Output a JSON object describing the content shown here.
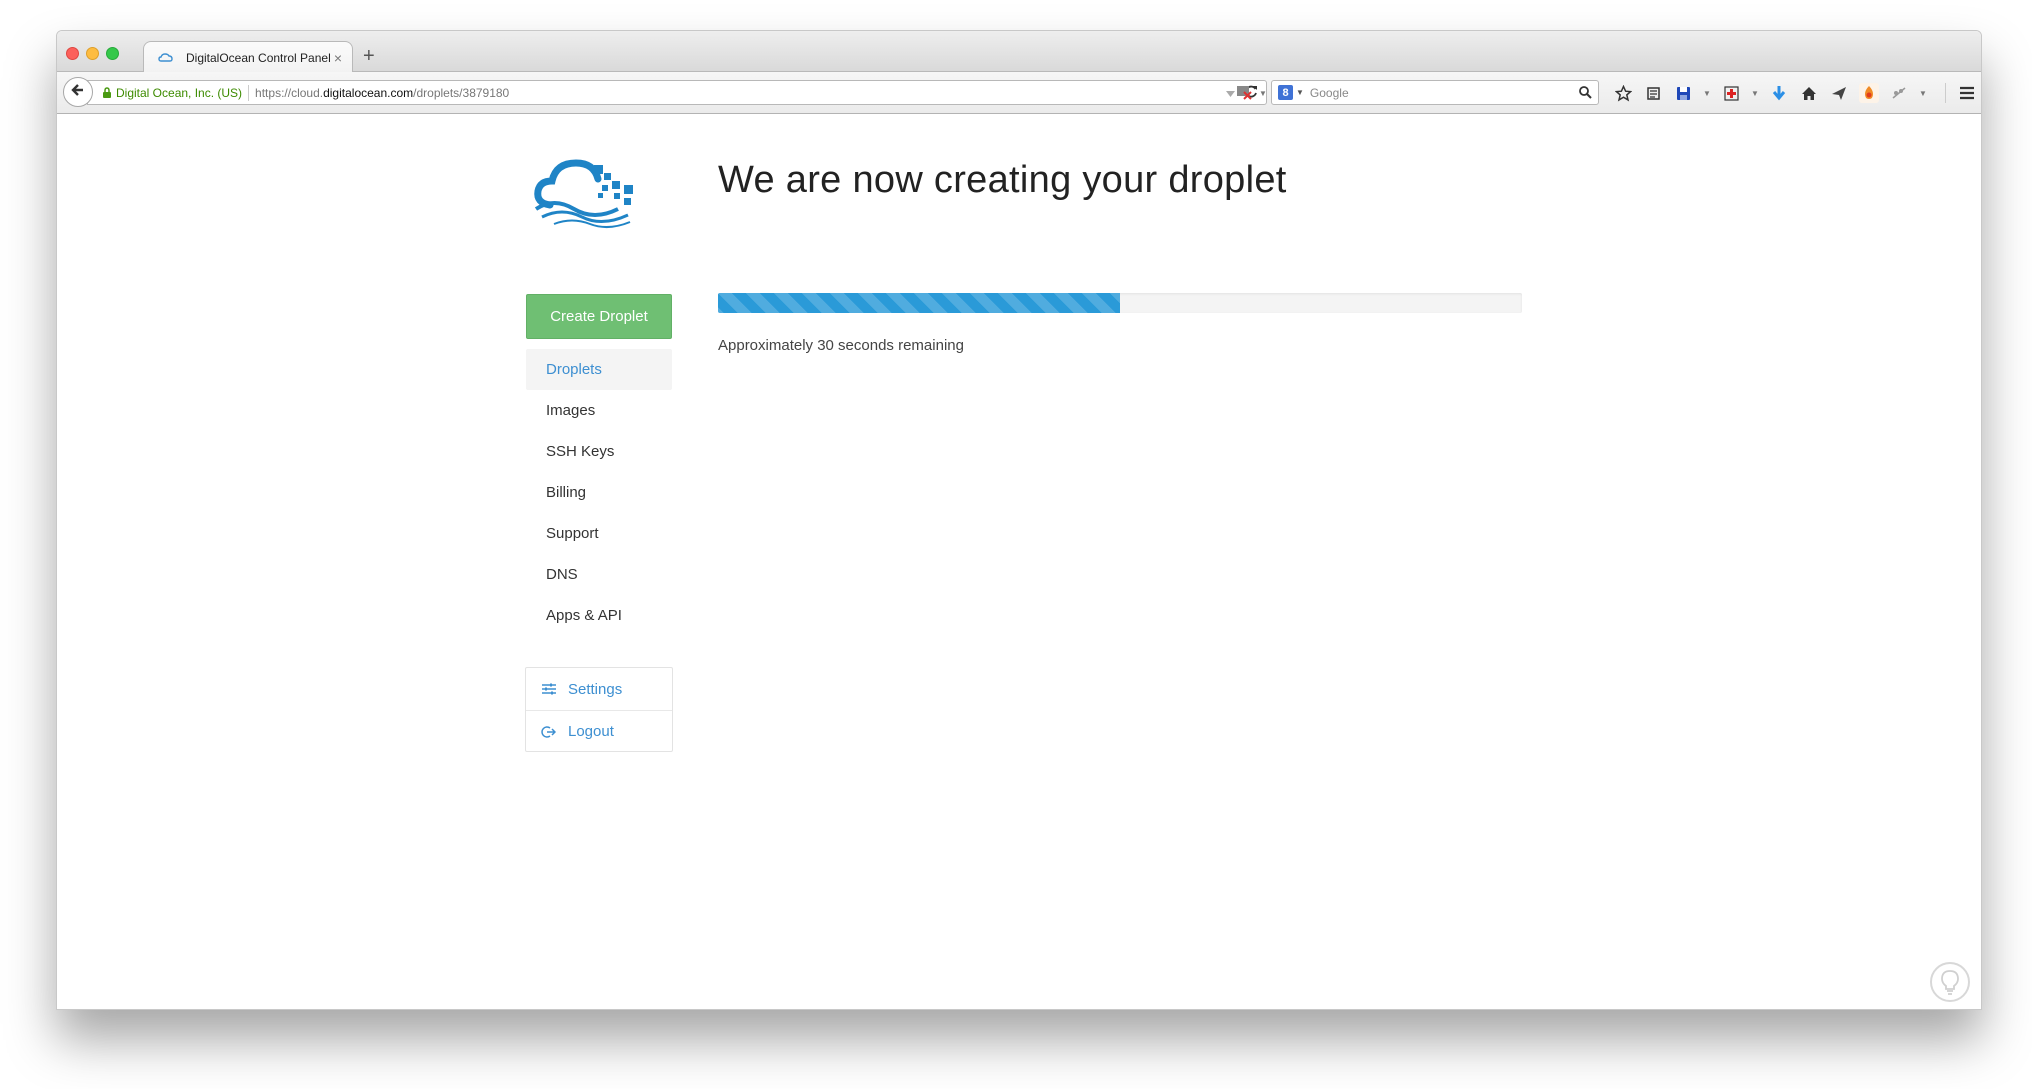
{
  "browser": {
    "tab_title": "DigitalOcean Control Panel",
    "tab_close": "×",
    "new_tab": "+",
    "identity": "Digital Ocean, Inc. (US)",
    "url_host": "https://cloud.",
    "url_domain": "digitalocean.com",
    "url_path": "/droplets/3879180",
    "search_placeholder": "Google",
    "search_engine_badge": "8"
  },
  "sidebar": {
    "create_button": "Create Droplet",
    "items": [
      {
        "label": "Droplets",
        "active": true
      },
      {
        "label": "Images"
      },
      {
        "label": "SSH Keys"
      },
      {
        "label": "Billing"
      },
      {
        "label": "Support"
      },
      {
        "label": "DNS"
      },
      {
        "label": "Apps & API"
      }
    ],
    "user_menu": {
      "settings": "Settings",
      "logout": "Logout"
    }
  },
  "main": {
    "heading": "We are now creating your droplet",
    "progress_fraction": 0.5,
    "progress_text": "Approximately 30 seconds remaining"
  },
  "colors": {
    "accent_blue": "#3d8fd1",
    "create_green": "#6fbf73",
    "progress_blue": "#2a9ad8"
  },
  "icons": [
    "cloud-favicon-icon",
    "back-arrow-icon",
    "lock-icon",
    "reload-icon",
    "search-icon",
    "bookmark-star-icon",
    "settings-sliders-icon",
    "logout-icon",
    "lightbulb-icon",
    "menu-icon"
  ]
}
